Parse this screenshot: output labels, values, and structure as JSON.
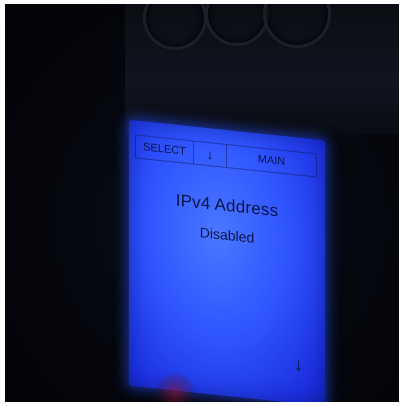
{
  "display": {
    "softkeys": {
      "select": "SELECT",
      "down_arrow": "↓",
      "main": "MAIN"
    },
    "line1": "IPv4 Address",
    "line2": "Disabled",
    "corner_arrow": "↓"
  },
  "colors": {
    "backlight": "#2f55ff",
    "text": "#0a1545",
    "housing": "#05070d"
  }
}
